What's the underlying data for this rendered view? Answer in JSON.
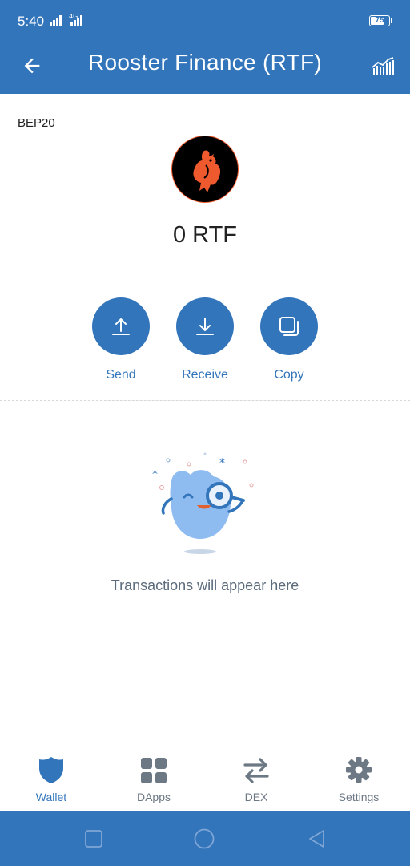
{
  "status_bar": {
    "time": "5:40",
    "network_type": "4G",
    "battery_level": "75",
    "battery_percent": 75
  },
  "app_bar": {
    "title": "Rooster Finance (RTF)",
    "back_icon": "arrow-left-icon",
    "chart_icon": "chart-icon"
  },
  "token": {
    "network": "BEP20",
    "logo": "rooster-logo",
    "balance": "0 RTF"
  },
  "actions": [
    {
      "label": "Send",
      "icon": "upload-arrow-icon"
    },
    {
      "label": "Receive",
      "icon": "download-arrow-icon"
    },
    {
      "label": "Copy",
      "icon": "copy-icon"
    }
  ],
  "empty_state": {
    "message": "Transactions will appear here",
    "illustration": "mascot-magnifier-illustration"
  },
  "bottom_nav": {
    "items": [
      {
        "label": "Wallet",
        "icon": "shield-icon",
        "active": true
      },
      {
        "label": "DApps",
        "icon": "grid-icon",
        "active": false
      },
      {
        "label": "DEX",
        "icon": "swap-arrows-icon",
        "active": false
      },
      {
        "label": "Settings",
        "icon": "gear-icon",
        "active": false
      }
    ]
  },
  "colors": {
    "primary": "#3375bb",
    "nav_inactive": "#6d7885",
    "text_dark": "#222222",
    "logo_orange": "#ee5a2e"
  }
}
